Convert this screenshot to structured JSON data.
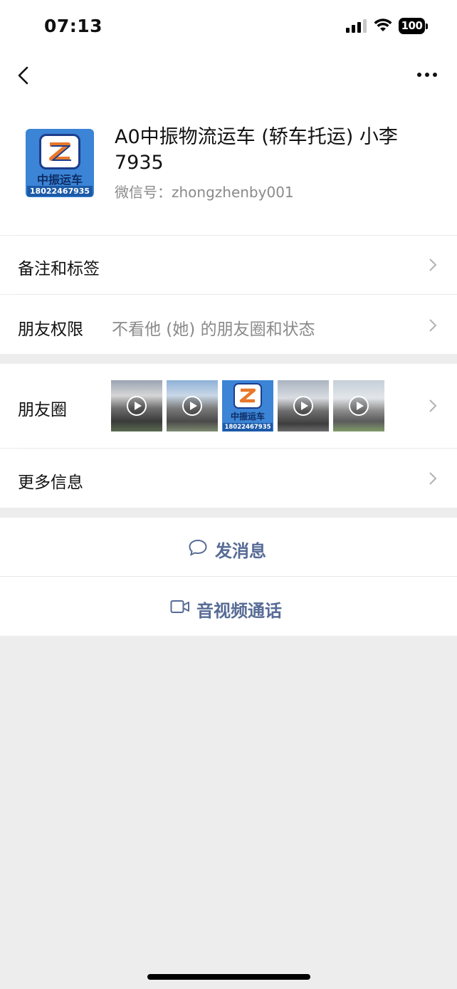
{
  "status_bar": {
    "time": "07:13",
    "battery": "100"
  },
  "profile": {
    "name": "A0中振物流运车 (轿车托运) 小李7935",
    "wechat_id": "微信号：zhongzhenby001",
    "avatar": {
      "brand_text": "中振运车",
      "phone_text": "18022467935"
    }
  },
  "rows": {
    "remarks": {
      "label": "备注和标签"
    },
    "permissions": {
      "label": "朋友权限",
      "value": "不看他 (她) 的朋友圈和状态"
    },
    "moments": {
      "label": "朋友圈"
    },
    "more_info": {
      "label": "更多信息"
    }
  },
  "moments_thumbnails": [
    {
      "kind": "video",
      "desc": "car carrier truck"
    },
    {
      "kind": "video",
      "desc": "car carrier truck"
    },
    {
      "kind": "logo",
      "brand_text": "中振运车",
      "phone_text": "18022467935"
    },
    {
      "kind": "video",
      "desc": "car carrier truck"
    },
    {
      "kind": "video",
      "desc": "car carrier truck"
    }
  ],
  "actions": {
    "send_message": "发消息",
    "video_call": "音视频通话"
  },
  "colors": {
    "link": "#576b95",
    "background": "#ededed",
    "avatar_blue": "#3b84d6"
  }
}
